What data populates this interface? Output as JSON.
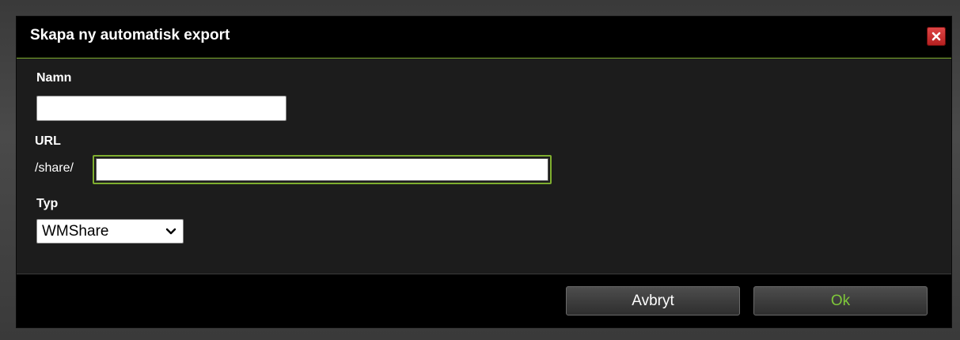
{
  "dialog": {
    "title": "Skapa ny automatisk export",
    "close_icon": "close-x-icon"
  },
  "form": {
    "name": {
      "label": "Namn",
      "value": ""
    },
    "url": {
      "label": "URL",
      "prefix": "/share/",
      "value": ""
    },
    "type": {
      "label": "Typ",
      "selected": "WMShare",
      "icon": "chevron-down-icon"
    }
  },
  "footer": {
    "cancel_label": "Avbryt",
    "ok_label": "Ok"
  },
  "colors": {
    "accent": "#7fae2f",
    "ok_text": "#7fc83a",
    "close_button": "#cc2f2f",
    "titlebar_bg": "#000000",
    "dialog_bg": "#1c1c1c"
  }
}
